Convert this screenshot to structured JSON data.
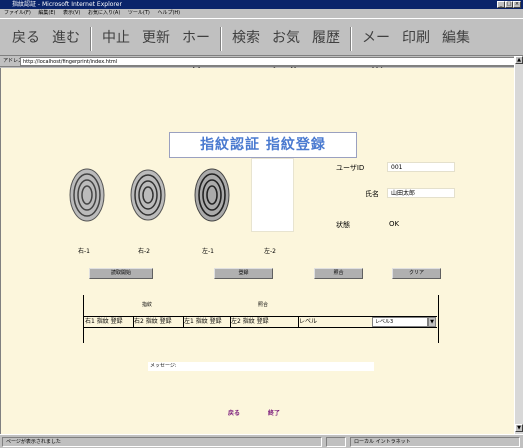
{
  "window": {
    "title": "指紋認証 - Microsoft Internet Explorer",
    "controls": [
      "_",
      "□",
      "×"
    ]
  },
  "menubar": {
    "items": [
      "ファイル(F)",
      "編集(E)",
      "表示(V)",
      "お気に入り(A)",
      "ツール(T)",
      "ヘルプ(H)"
    ]
  },
  "toolbar": {
    "buttons": [
      "戻る",
      "進む",
      "中止",
      "更新",
      "ホーム",
      "検索",
      "お気に入り",
      "履歴",
      "メール",
      "印刷",
      "編集"
    ]
  },
  "address": {
    "label": "アドレス",
    "value": "http://localhost/fingerprint/index.html"
  },
  "page": {
    "heading": "指紋認証 指紋登録",
    "fingerprint_labels": [
      "右-1",
      "右-2",
      "左-1",
      "左-2"
    ],
    "form": {
      "id_label": "ユーザID",
      "id_value": "001",
      "name_label": "氏名",
      "name_value": "山田太郎",
      "status_label": "状態",
      "status_value": "OK"
    },
    "buttons": [
      "読取開始",
      "登録",
      "照合",
      "クリア"
    ],
    "table": {
      "headers": [
        "指紋",
        "照合"
      ],
      "cells": [
        "右1 指紋 登録",
        "右2 指紋 登録",
        "左1 指紋 登録",
        "左2 指紋 登録",
        "レベル"
      ],
      "select_value": "レベル3"
    },
    "message_label": "メッセージ:",
    "links": [
      "戻る",
      "終了"
    ]
  },
  "statusbar": {
    "left": "ページが表示されました",
    "right": "ローカル イントラネット"
  }
}
